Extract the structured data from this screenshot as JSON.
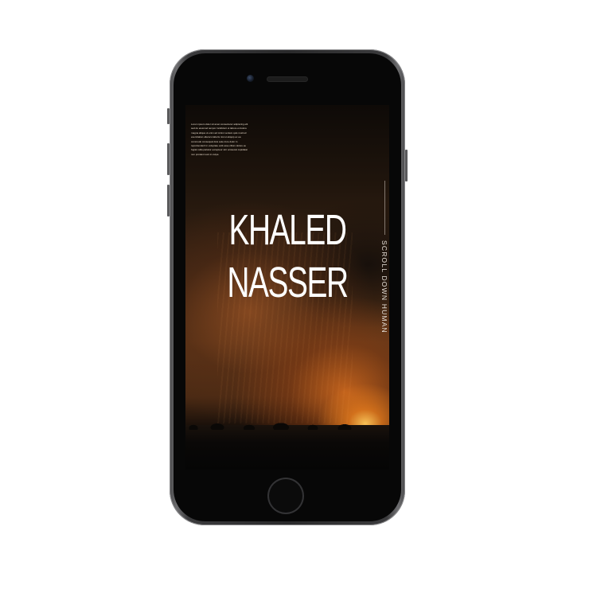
{
  "page": {
    "background": "#ffffff"
  },
  "device": {
    "model": "smartphone",
    "body_color": "#2a2a2b",
    "icons": [
      "front-camera-icon",
      "earpiece-icon",
      "home-button-icon"
    ]
  },
  "screen": {
    "intro_text": "Lorem ipsum dolor sit amet consectetur adipiscing elit sed do eiusmod tempor incididunt ut labore et dolore magna aliqua ut enim ad minim veniam quis nostrud exercitation ullamco laboris nisi ut aliquip ex ea commodo consequat duis aute irure dolor in reprehenderit in voluptate velit esse cillum dolore eu fugiat nulla pariatur excepteur sint occaecat cupidatat non proident sunt in culpa",
    "title_line1": "KHALED",
    "title_line2": "NASSER",
    "scroll_hint": "SCROLL DOWN HUMAN",
    "text_color": "#ffffff",
    "accent_glow": "#f0a040"
  }
}
